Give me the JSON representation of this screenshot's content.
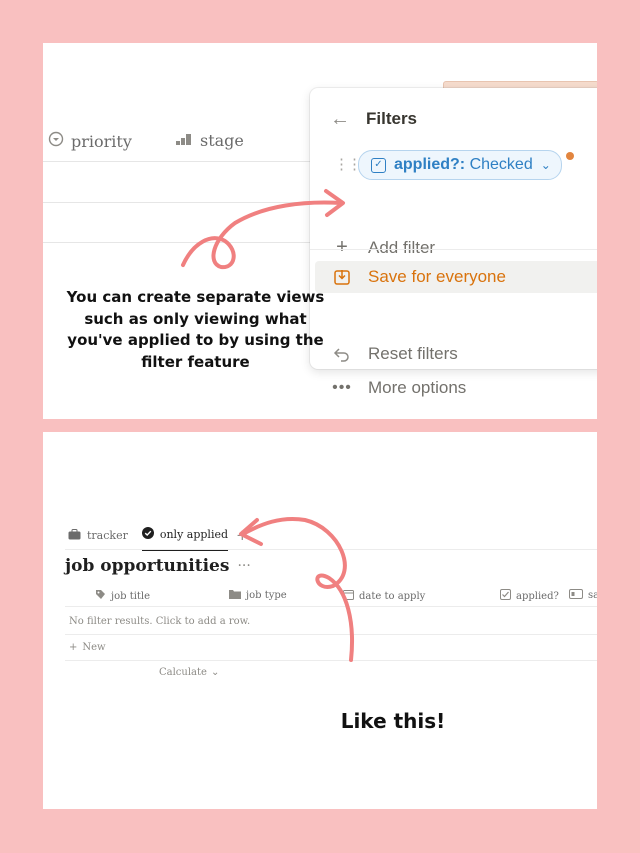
{
  "top": {
    "columns": [
      {
        "label": "priority",
        "icon": "select-icon"
      },
      {
        "label": "stage",
        "icon": "status-bars-icon"
      }
    ],
    "filter_popup": {
      "title": "Filters",
      "chip_prop": "applied?:",
      "chip_value": "Checked",
      "add_filter": "Add filter",
      "save": "Save for everyone",
      "reset": "Reset filters",
      "more": "More options"
    },
    "caption": "You can create separate views such as only viewing what you've applied to by using the filter feature"
  },
  "bottom": {
    "tabs": [
      {
        "label": "tracker",
        "icon": "briefcase-icon"
      },
      {
        "label": "only applied",
        "icon": "check-circle-icon"
      }
    ],
    "add_view": "+",
    "database_title": "job opportunities",
    "more_menu": "···",
    "properties": [
      {
        "label": "job title",
        "icon": "tag-icon"
      },
      {
        "label": "job type",
        "icon": "folder-icon"
      },
      {
        "label": "date to apply",
        "icon": "calendar-icon"
      },
      {
        "label": "applied?",
        "icon": "checkbox-icon"
      },
      {
        "label": "sa",
        "icon": "id-card-icon"
      }
    ],
    "empty_message": "No filter results. Click to add a row.",
    "new_row": "New",
    "calculate": "Calculate",
    "caption": "Like this!"
  },
  "colors": {
    "background": "#f9c0c0",
    "accent_orange": "#d9730d",
    "chip_blue": "#2f80c4",
    "arrow": "#f08080"
  }
}
